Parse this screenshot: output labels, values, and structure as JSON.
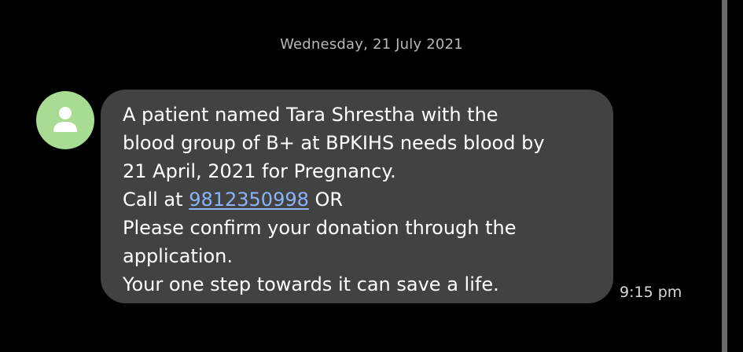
{
  "conversation": {
    "date_header": "Wednesday, 21 July 2021"
  },
  "message": {
    "lines": {
      "l1": "A patient named Tara Shrestha with the",
      "l2": "blood group of B+ at BPKIHS needs blood by",
      "l3": "21 April, 2021 for Pregnancy.",
      "l4_prefix": "Call at ",
      "l4_phone": "9812350998",
      "l4_suffix": " OR",
      "l5": "Please confirm your donation through the",
      "l6": "application.",
      "l7": "Your one step towards it can save a life."
    },
    "time": "9:15 pm"
  },
  "sender": {
    "avatar_icon": "person-icon",
    "avatar_color": "#a9dc93"
  },
  "colors": {
    "background": "#000000",
    "bubble": "#424242",
    "link": "#8ab4f8",
    "date_text": "#b8b8b8"
  }
}
